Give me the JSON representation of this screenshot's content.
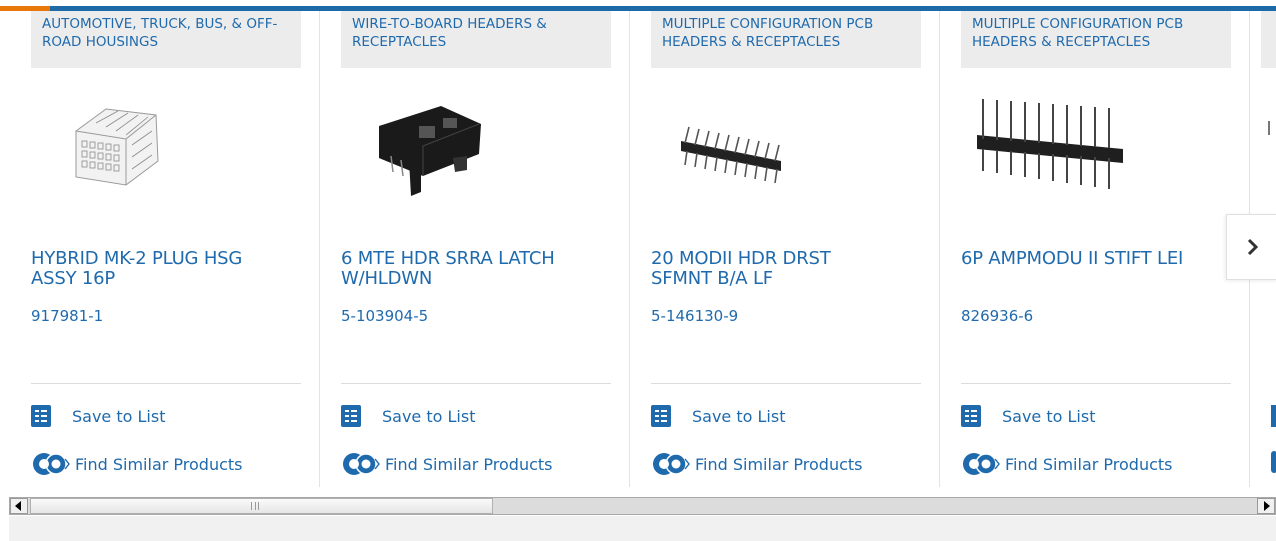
{
  "colors": {
    "accent_blue": "#1f6aad",
    "accent_orange": "#e8780c",
    "category_bg": "#ececec"
  },
  "products": [
    {
      "category": "AUTOMOTIVE, TRUCK, BUS, & OFF-ROAD HOUSINGS",
      "title": "HYBRID MK-2 PLUG HSG\nASSY 16P",
      "part_number": "917981-1",
      "save_label": "Save to List",
      "find_label": "Find Similar Products"
    },
    {
      "category": "WIRE-TO-BOARD HEADERS & RECEPTACLES",
      "title": "6 MTE HDR SRRA LATCH\nW/HLDWN",
      "part_number": "5-103904-5",
      "save_label": "Save to List",
      "find_label": "Find Similar Products"
    },
    {
      "category": "MULTIPLE CONFIGURATION PCB HEADERS & RECEPTACLES",
      "title": "20 MODII HDR DRST\nSFMNT B/A LF",
      "part_number": "5-146130-9",
      "save_label": "Save to List",
      "find_label": "Find Similar Products"
    },
    {
      "category": "MULTIPLE CONFIGURATION PCB HEADERS & RECEPTACLES",
      "title": "6P AMPMODU II STIFT LEI",
      "part_number": "826936-6",
      "save_label": "Save to List",
      "find_label": "Find Similar Products"
    }
  ],
  "icons": {
    "save": "checklist-icon",
    "find": "similar-products-icon",
    "next": "chevron-right-icon"
  }
}
